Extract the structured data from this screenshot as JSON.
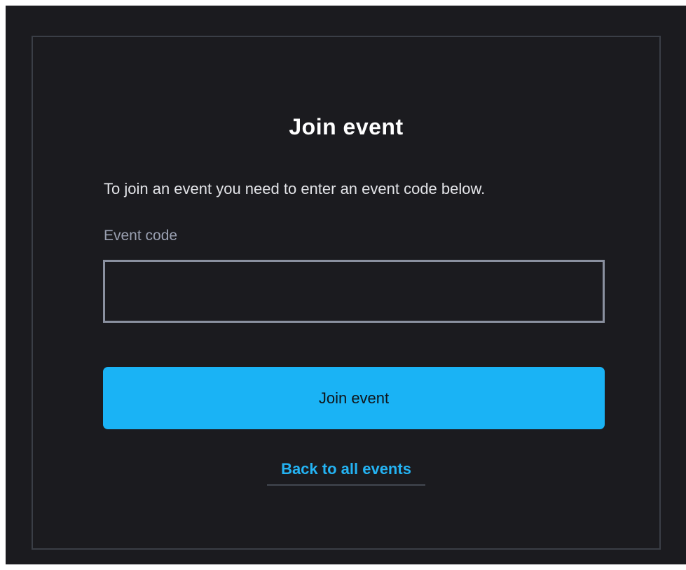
{
  "form": {
    "title": "Join event",
    "description": "To join an event you need to enter an event code below.",
    "field_label": "Event code",
    "field_value": "",
    "field_placeholder": "",
    "submit_label": "Join event",
    "back_link_label": "Back to all events"
  },
  "colors": {
    "background": "#1b1b1f",
    "card_border": "#3a3e46",
    "accent": "#1ab3f5",
    "link": "#24b3f3",
    "label_muted": "#9aa0b1",
    "input_border": "#8a909f"
  }
}
